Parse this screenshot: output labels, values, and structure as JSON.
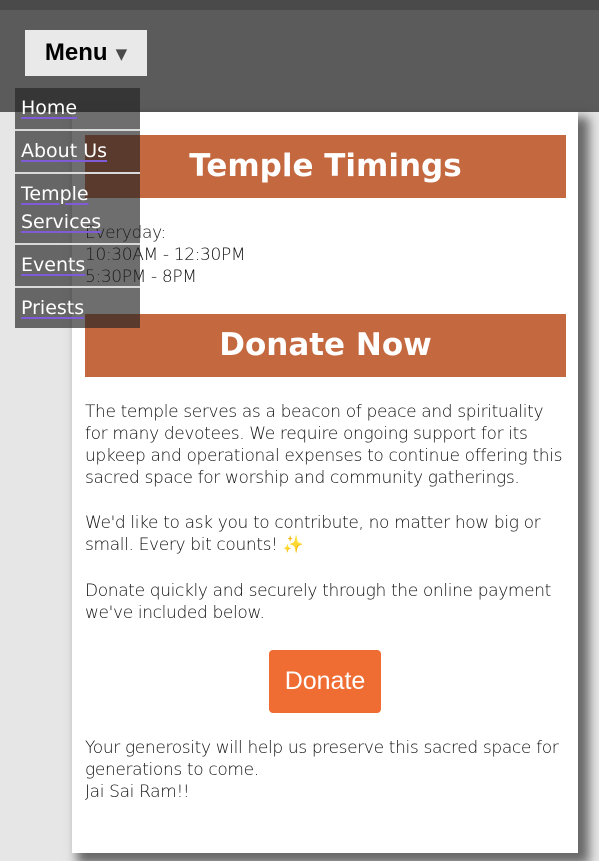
{
  "header": {
    "menu_label": "Menu",
    "menu_caret": "▼"
  },
  "nav": {
    "items": [
      {
        "label": "Home"
      },
      {
        "label": "About Us"
      },
      {
        "label": "Temple Services"
      },
      {
        "label": "Events"
      },
      {
        "label": "Priests"
      }
    ]
  },
  "timings": {
    "heading": "Temple Timings",
    "day_label": "Everyday:",
    "morning": "10:30AM - 12:30PM",
    "evening": "5:30PM - 8PM"
  },
  "donate": {
    "heading": "Donate Now",
    "para1": "The temple serves as a beacon of peace and spirituality for many devotees. We require ongoing support for its upkeep and operational expenses to continue offering this sacred space for worship and community gatherings.",
    "para2": "We'd like to ask you to contribute, no matter how big or small. Every bit counts!",
    "para2_emoji": "✨",
    "para3": "Donate quickly and securely through the online payment we've included below.",
    "button_label": "Donate",
    "closing1": "Your generosity will help us preserve this sacred space for generations to come.",
    "closing2": "Jai Sai Ram!!"
  },
  "colors": {
    "banner": "#c4683f",
    "button": "#ef6c33",
    "topbar": "#5b5b5b",
    "link_underline": "#7f5bd6"
  }
}
